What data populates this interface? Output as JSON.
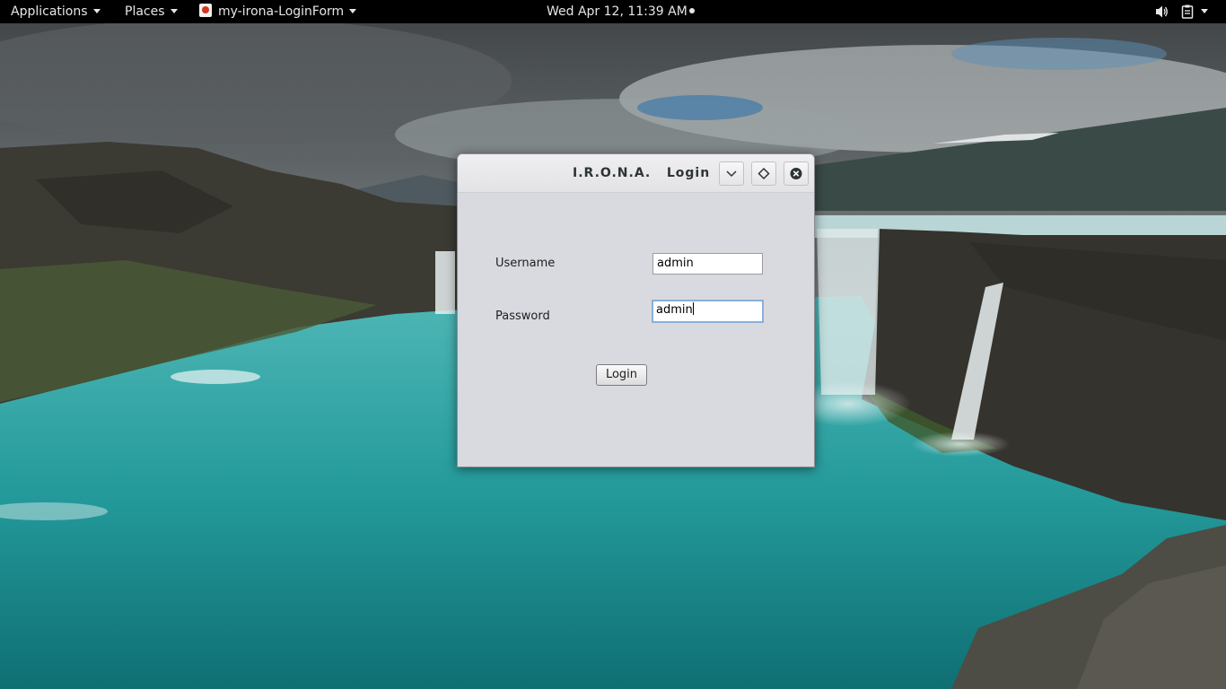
{
  "topbar": {
    "applications_label": "Applications",
    "places_label": "Places",
    "active_app_label": "my-irona-LoginForm",
    "clock": "Wed Apr 12, 11:39 AM",
    "icons": [
      "volume-icon",
      "clipboard-icon",
      "system-menu-icon"
    ]
  },
  "dialog": {
    "title": "I.R.O.N.A.   Login",
    "buttons": [
      "minimize",
      "maximize",
      "close"
    ],
    "username_label": "Username",
    "username_value": "admin",
    "password_label": "Password",
    "password_value": "admin",
    "login_button_label": "Login"
  },
  "colors": {
    "topbar_bg": "#000000",
    "dialog_bg": "#d9dae0",
    "focus_ring": "#8ab0d8",
    "water": "#2a9c9e"
  }
}
